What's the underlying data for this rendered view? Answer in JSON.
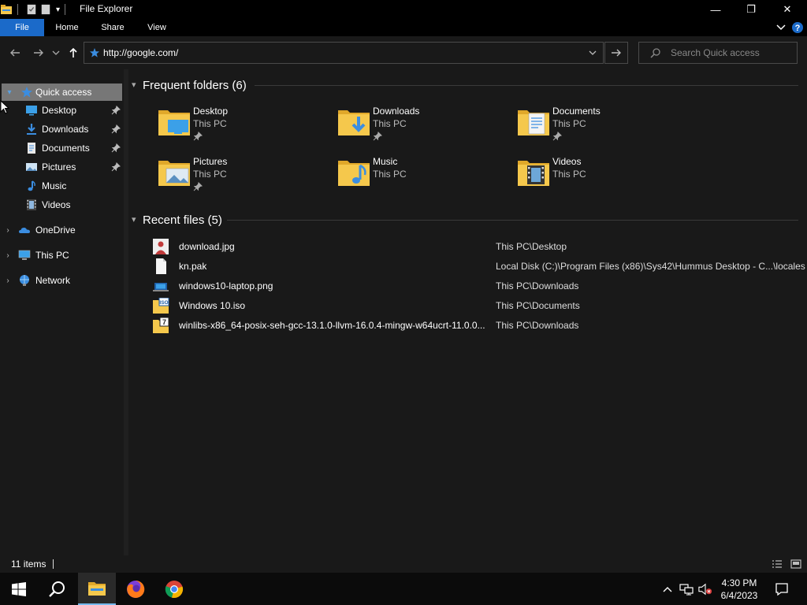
{
  "window": {
    "title": "File Explorer",
    "controls": {
      "minimize": "—",
      "restore": "❐",
      "close": "✕"
    }
  },
  "ribbon": {
    "tabs": [
      "File",
      "Home",
      "Share",
      "View"
    ],
    "expand_icon": "chevron-down-icon",
    "help_icon": "help-icon"
  },
  "address": {
    "value": "http://google.com/",
    "search_placeholder": "Search Quick access"
  },
  "nav_pane": {
    "items": [
      {
        "label": "Quick access",
        "icon": "star-icon",
        "selected": true
      },
      {
        "label": "Desktop",
        "icon": "desktop-icon",
        "pinned": true
      },
      {
        "label": "Downloads",
        "icon": "downloads-icon",
        "pinned": true
      },
      {
        "label": "Documents",
        "icon": "documents-icon",
        "pinned": true
      },
      {
        "label": "Pictures",
        "icon": "pictures-icon",
        "pinned": true
      },
      {
        "label": "Music",
        "icon": "music-icon"
      },
      {
        "label": "Videos",
        "icon": "videos-icon"
      },
      {
        "label": "OneDrive",
        "icon": "onedrive-icon"
      },
      {
        "label": "This PC",
        "icon": "this-pc-icon"
      },
      {
        "label": "Network",
        "icon": "network-icon"
      }
    ]
  },
  "frequent_folders": {
    "title": "Frequent folders (6)",
    "items": [
      {
        "name": "Desktop",
        "location": "This PC",
        "pinned": true,
        "icon": "desktop-folder-icon"
      },
      {
        "name": "Downloads",
        "location": "This PC",
        "pinned": true,
        "icon": "downloads-folder-icon"
      },
      {
        "name": "Documents",
        "location": "This PC",
        "pinned": true,
        "icon": "documents-folder-icon"
      },
      {
        "name": "Pictures",
        "location": "This PC",
        "pinned": true,
        "icon": "pictures-folder-icon"
      },
      {
        "name": "Music",
        "location": "This PC",
        "pinned": false,
        "icon": "music-folder-icon"
      },
      {
        "name": "Videos",
        "location": "This PC",
        "pinned": false,
        "icon": "videos-folder-icon"
      }
    ]
  },
  "recent_files": {
    "title": "Recent files (5)",
    "items": [
      {
        "name": "download.jpg",
        "path": "This PC\\Desktop",
        "icon": "image-file-icon"
      },
      {
        "name": "kn.pak",
        "path": "Local Disk (C:)\\Program Files (x86)\\Sys42\\Hummus Desktop - C...\\locales",
        "icon": "blank-file-icon"
      },
      {
        "name": "windows10-laptop.png",
        "path": "This PC\\Downloads",
        "icon": "image-file-icon"
      },
      {
        "name": "Windows 10.iso",
        "path": "This PC\\Documents",
        "icon": "iso-file-icon"
      },
      {
        "name": "winlibs-x86_64-posix-seh-gcc-13.1.0-llvm-16.0.4-mingw-w64ucrt-11.0.0...",
        "path": "This PC\\Downloads",
        "icon": "archive-file-icon"
      }
    ]
  },
  "status": {
    "items_count": "11 items"
  },
  "taskbar": {
    "time": "4:30 PM",
    "date": "6/4/2023"
  },
  "colors": {
    "accent": "#1b6ac9",
    "pane_bg": "#191919",
    "selected_bg": "#777777",
    "folder_yellow": "#f5c84c"
  }
}
